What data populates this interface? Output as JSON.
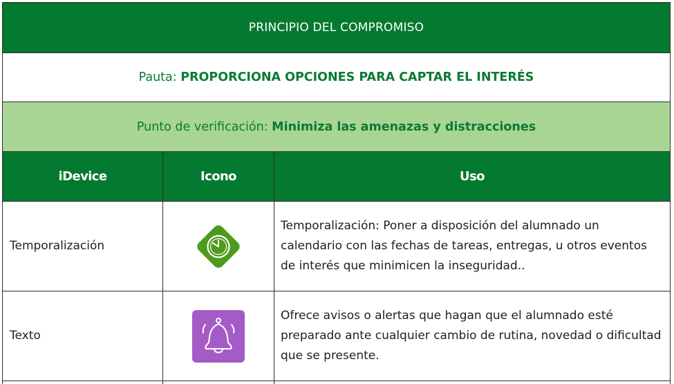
{
  "principle": "PRINCIPIO DEL COMPROMISO",
  "pauta": {
    "label": "Pauta: ",
    "value": "PROPORCIONA OPCIONES PARA CAPTAR EL INTERÉS"
  },
  "punto": {
    "label": "Punto de verificación: ",
    "value": "Minimiza las amenazas y distracciones"
  },
  "columns": {
    "idevice": "iDevice",
    "icono": "Icono",
    "uso": "Uso"
  },
  "rows": [
    {
      "idevice": "Temporalización",
      "icon": "clock-icon",
      "uso": "Temporalización: Poner a disposición del alumnado un calendario con las fechas de tareas, entregas, u otros eventos de interés que minimicen la inseguridad.."
    },
    {
      "idevice": "Texto",
      "icon": "bell-icon",
      "uso": "Ofrece avisos o alertas que hagan que el alumnado esté preparado ante cualquier cambio de rutina, novedad o dificultad que se presente."
    }
  ],
  "colors": {
    "banner": "#047a30",
    "accent_text": "#0b7a33",
    "checkpoint_bg": "#a8d594",
    "clock_icon": "#4e9a1e",
    "bell_icon": "#a55bc5"
  }
}
